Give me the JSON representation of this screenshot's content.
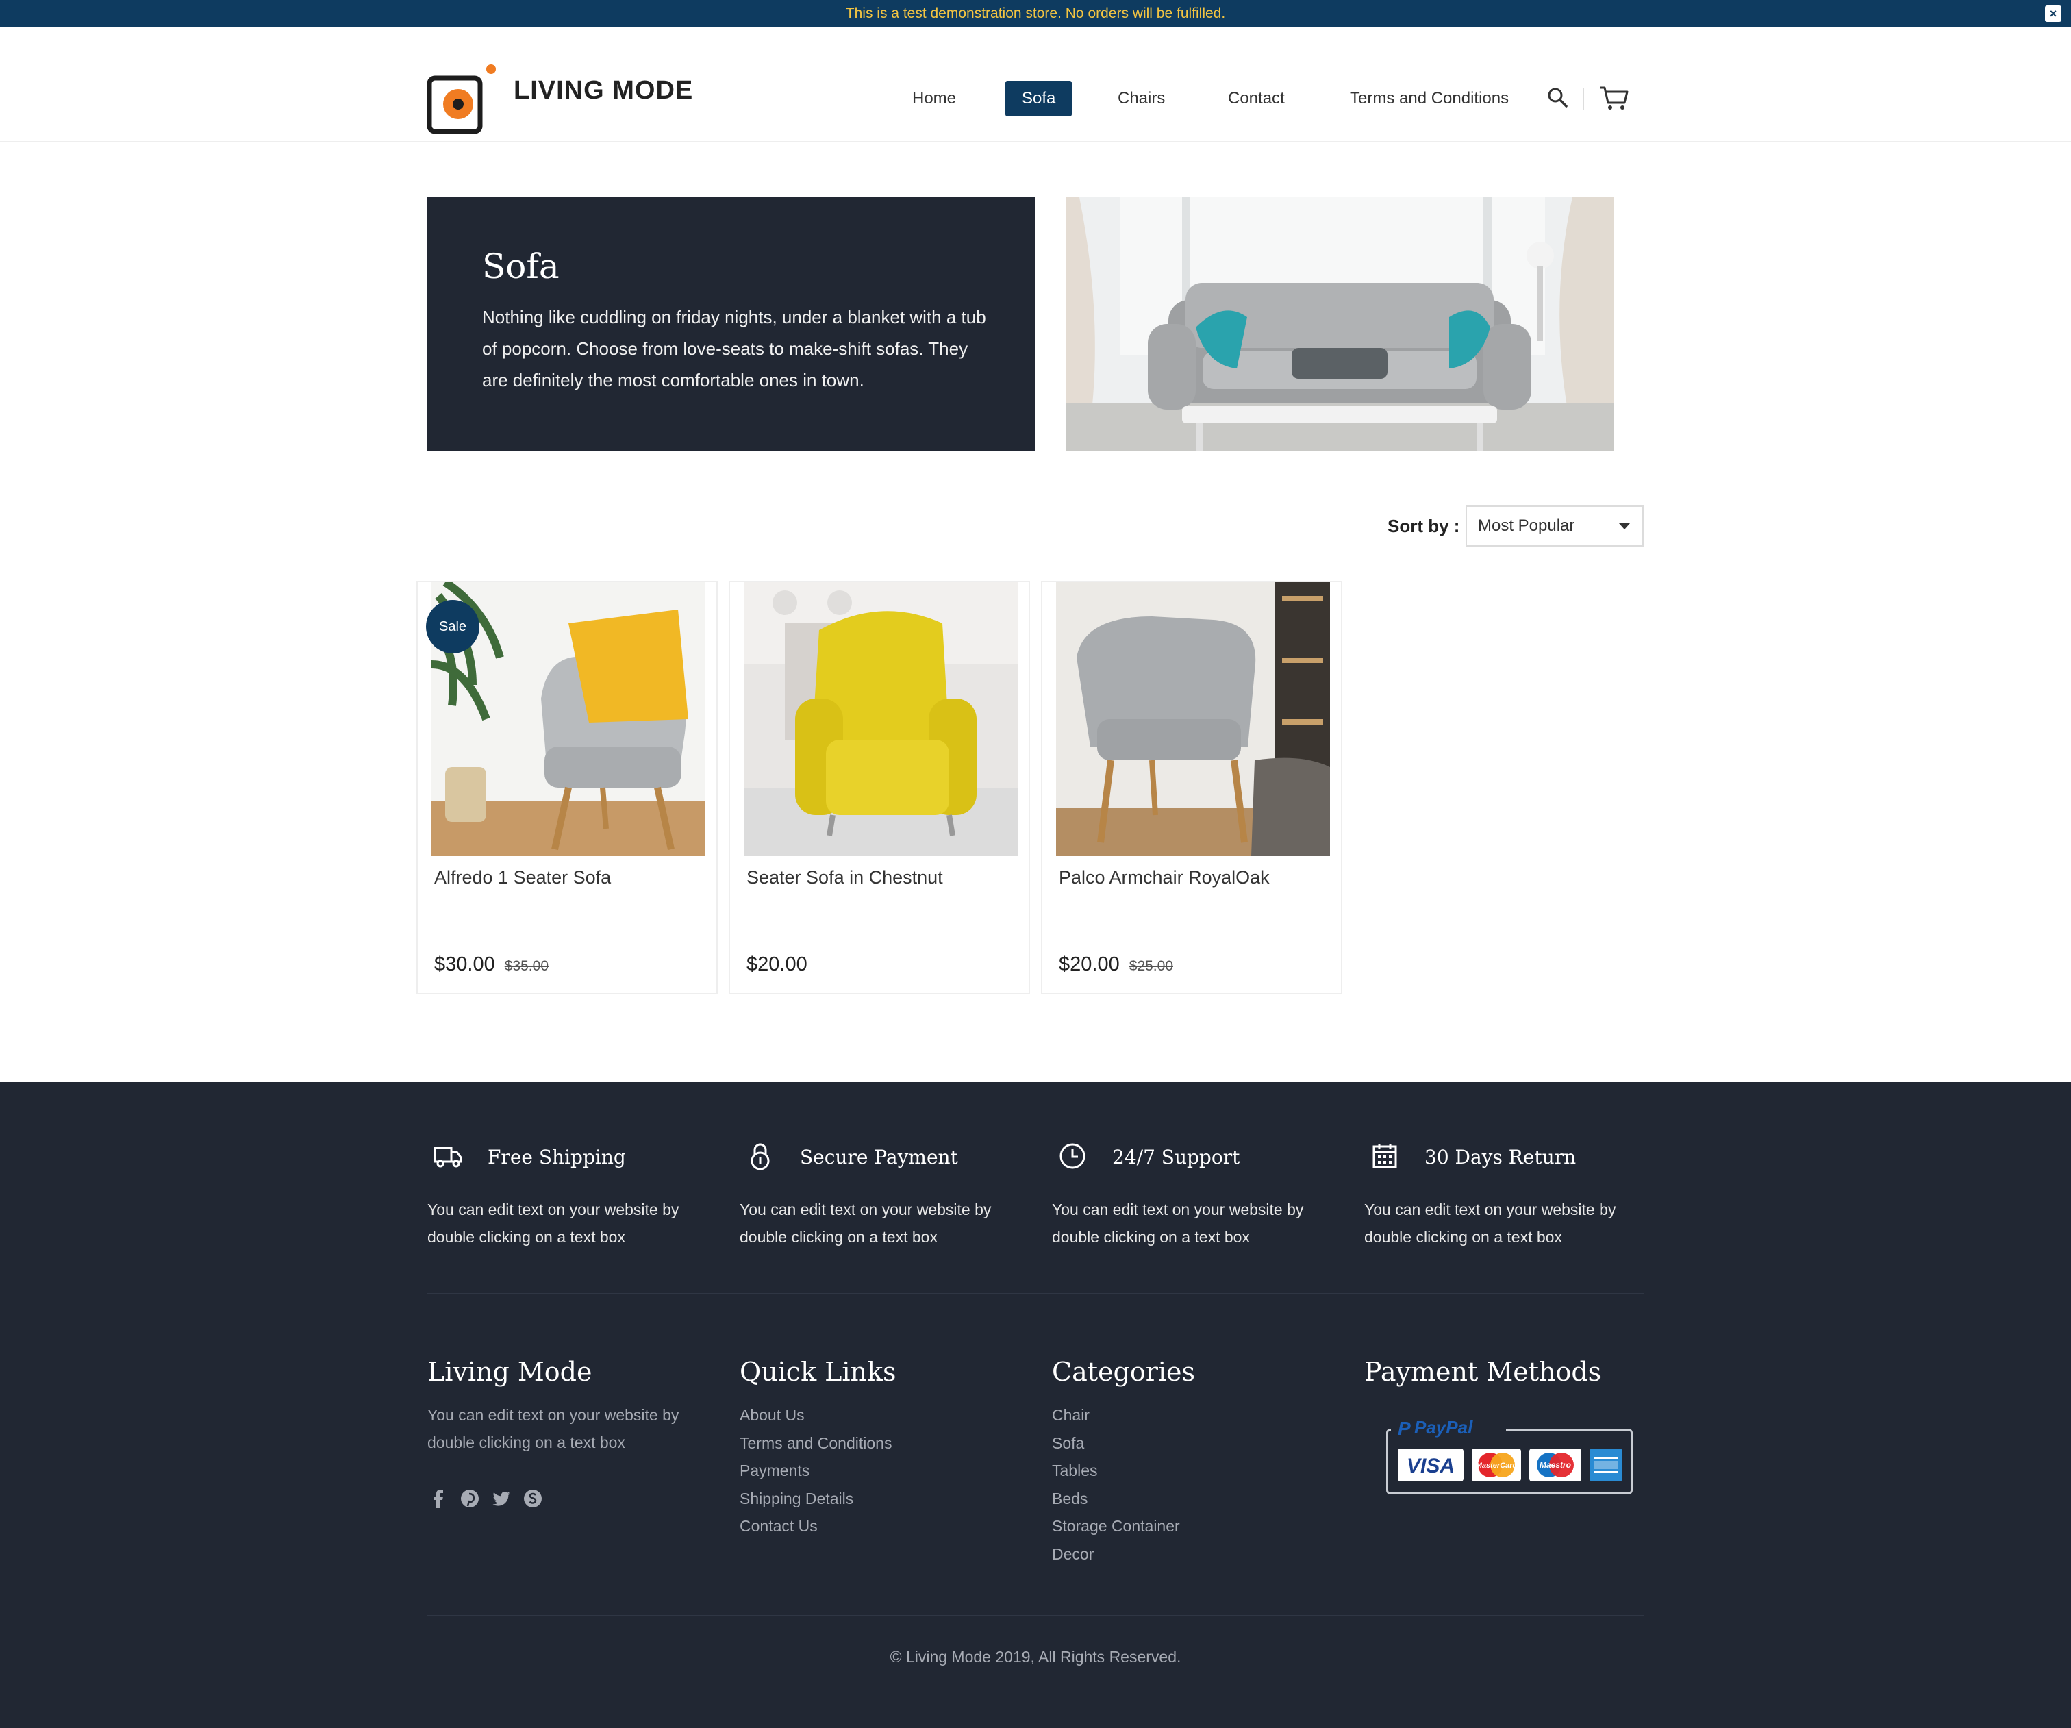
{
  "announcement": {
    "text": "This is a test demonstration store. No orders will be fulfilled.",
    "close_label": "×"
  },
  "header": {
    "logo_text": "LIVING MODE",
    "nav": [
      "Home",
      "Sofa",
      "Chairs",
      "Contact",
      "Terms and Conditions"
    ],
    "active_nav": "Sofa",
    "icons": [
      "search-icon",
      "cart-icon"
    ]
  },
  "hero": {
    "title": "Sofa",
    "description": "Nothing like cuddling on friday nights, under a blanket with a tub of popcorn. Choose from love-seats to make-shift sofas. They are definitely the most comfortable ones in town."
  },
  "sort": {
    "label": "Sort by :",
    "selected": "Most Popular"
  },
  "products": [
    {
      "name": "Alfredo 1 Seater Sofa",
      "price": "$30.00",
      "old_price": "$35.00",
      "badge": "Sale"
    },
    {
      "name": "Seater Sofa in Chestnut",
      "price": "$20.00",
      "old_price": "",
      "badge": ""
    },
    {
      "name": "Palco Armchair RoyalOak",
      "price": "$20.00",
      "old_price": "$25.00",
      "badge": ""
    }
  ],
  "features": [
    {
      "title": "Free Shipping",
      "text": "You can edit text on your website by double clicking on a text box",
      "icon": "truck-icon"
    },
    {
      "title": "Secure Payment",
      "text": "You can edit text on your website by double clicking on a text box",
      "icon": "lock-icon"
    },
    {
      "title": "24/7 Support",
      "text": "You can edit text on your website by double clicking on a text box",
      "icon": "clock-icon"
    },
    {
      "title": "30 Days Return",
      "text": "You can edit text on your website by double clicking on a text box",
      "icon": "calendar-icon"
    }
  ],
  "footer": {
    "about": {
      "title": "Living Mode",
      "text": "You can edit text on your website by double clicking on a text box",
      "social": [
        "facebook-icon",
        "pinterest-icon",
        "twitter-icon",
        "skype-icon"
      ]
    },
    "quick_links": {
      "title": "Quick Links",
      "items": [
        "About Us",
        "Terms and Conditions",
        "Payments",
        "Shipping Details",
        "Contact Us"
      ]
    },
    "categories": {
      "title": "Categories",
      "items": [
        "Chair",
        "Sofa",
        "Tables",
        "Beds",
        "Storage Container",
        "Decor"
      ]
    },
    "payment": {
      "title": "Payment Methods",
      "brands": [
        "PayPal",
        "VISA",
        "MasterCard",
        "Maestro",
        "American Express"
      ]
    },
    "copyright": "© Living Mode 2019, All Rights Reserved."
  },
  "colors": {
    "primary": "#0e3b60",
    "dark": "#212733",
    "accent": "#f07c22",
    "announcement_text": "#f4c542"
  }
}
